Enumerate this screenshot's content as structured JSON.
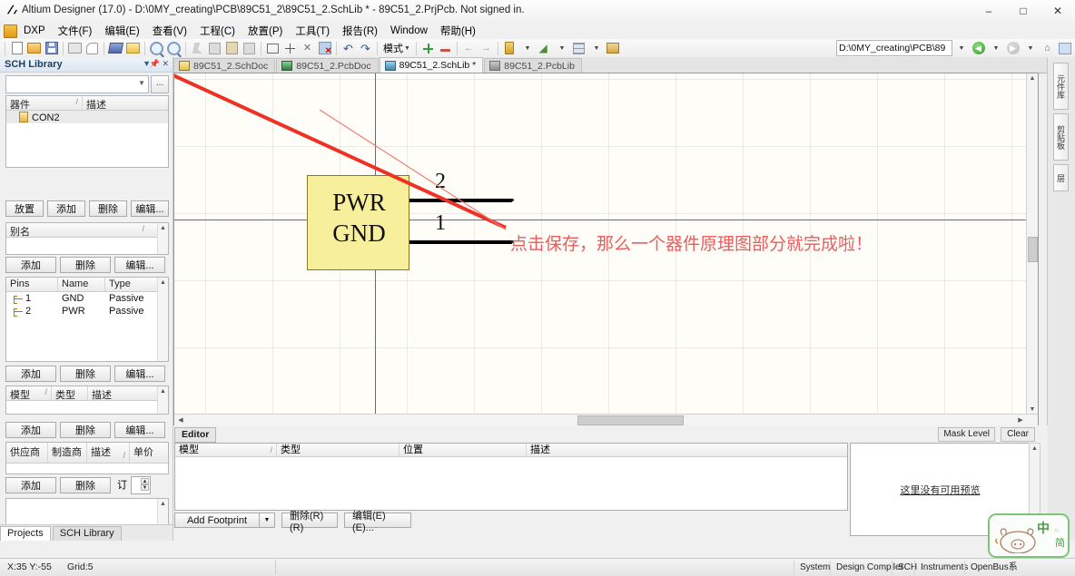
{
  "window": {
    "title": "Altium Designer (17.0) - D:\\0MY_creating\\PCB\\89C51_2\\89C51_2.SchLib * - 89C51_2.PrjPcb. Not signed in.",
    "minimize": "–",
    "maximize": "□",
    "close": "✕"
  },
  "menubar": {
    "items": [
      {
        "label": "DXP",
        "underline": "X"
      },
      {
        "label": "文件(F)",
        "underline": "F"
      },
      {
        "label": "编辑(E)",
        "underline": "E"
      },
      {
        "label": "查看(V)",
        "underline": "V"
      },
      {
        "label": "工程(C)",
        "underline": "C"
      },
      {
        "label": "放置(P)",
        "underline": "P"
      },
      {
        "label": "工具(T)",
        "underline": "T"
      },
      {
        "label": "报告(R)",
        "underline": "R"
      },
      {
        "label": "Window",
        "underline": "W"
      },
      {
        "label": "帮助(H)",
        "underline": "H"
      }
    ]
  },
  "toolbar": {
    "mode_label": "模式",
    "address_value": "D:\\0MY_creating\\PCB\\89",
    "buttons": [
      "new-document-icon",
      "open-folder-icon",
      "save-icon",
      "print-icon",
      "print-preview-icon",
      "layers-icon",
      "document-options-icon",
      "zoom-in-icon",
      "zoom-out-icon",
      "cut-icon",
      "copy-icon",
      "paste-icon",
      "paste-special-icon",
      "select-rectangle-icon",
      "move-icon",
      "deselect-icon",
      "clear-filter-icon",
      "undo-icon",
      "redo-icon",
      "add-icon",
      "remove-icon",
      "previous-part-icon",
      "next-part-icon",
      "place-pin-icon",
      "place-polygon-icon",
      "grid-icon",
      "place-image-icon"
    ],
    "nav": [
      "back-icon",
      "forward-icon",
      "home-icon",
      "refresh-icon"
    ]
  },
  "left_panel": {
    "title": "SCH Library",
    "header_buttons": [
      "chevron-down-icon",
      "pin-icon",
      "close-icon"
    ],
    "library_select": {
      "value": "",
      "ellipsis": "..."
    },
    "components": {
      "columns": [
        "器件",
        "描述"
      ],
      "sort_marker": "/",
      "rows": [
        {
          "name": "CON2",
          "description": ""
        }
      ]
    },
    "component_buttons": [
      "放置",
      "添加",
      "删除",
      "编辑..."
    ],
    "alias": {
      "columns": [
        "别名"
      ],
      "sort_marker": "/",
      "rows": [],
      "buttons": [
        "添加",
        "删除",
        "编辑..."
      ]
    },
    "pins": {
      "columns": [
        "Pins",
        "Name",
        "Type"
      ],
      "rows": [
        {
          "pin": "1",
          "name": "GND",
          "type": "Passive"
        },
        {
          "pin": "2",
          "name": "PWR",
          "type": "Passive"
        }
      ],
      "buttons": [
        "添加",
        "删除",
        "编辑..."
      ]
    },
    "models": {
      "columns": [
        "模型",
        "类型",
        "描述"
      ],
      "sort_marker": "/",
      "rows": [],
      "buttons": [
        "添加",
        "删除",
        "编辑..."
      ]
    },
    "suppliers": {
      "columns": [
        "供应商",
        "制造商",
        "描述",
        "单价"
      ],
      "sort_marker": "/",
      "rows": [],
      "buttons": [
        "添加",
        "删除"
      ],
      "order_label": "订"
    },
    "tabs": [
      {
        "label": "Projects",
        "active": true
      },
      {
        "label": "SCH Library",
        "active": false
      }
    ]
  },
  "doc_tabs": [
    {
      "label": "89C51_2.SchDoc",
      "icon": "schdoc-icon",
      "active": false,
      "modified": false
    },
    {
      "label": "89C51_2.PcbDoc",
      "icon": "pcbdoc-icon",
      "active": false,
      "modified": false
    },
    {
      "label": "89C51_2.SchLib *",
      "icon": "schlib-icon",
      "active": true,
      "modified": true
    },
    {
      "label": "89C51_2.PcbLib",
      "icon": "pcblib-icon",
      "active": false,
      "modified": false
    }
  ],
  "canvas": {
    "symbol": {
      "line1": "PWR",
      "line2": "GND",
      "fill_color": "#f7ef9c",
      "border_color": "#8a7a1e"
    },
    "pins": [
      {
        "number": "2",
        "net": "PWR"
      },
      {
        "number": "1",
        "net": "GND"
      }
    ],
    "annotation": {
      "text": "点击保存，那么一个器件原理图部分就完成啦！",
      "color": "#ef5b5b"
    },
    "pointer_color": "#ee3124"
  },
  "right_edge_tabs": [
    "元件库",
    "剪贴板",
    "层"
  ],
  "editor_pane": {
    "tab": "Editor",
    "mask_level": "Mask Level",
    "clear": "Clear",
    "footprint_table": {
      "columns": [
        "模型",
        "类型",
        "位置",
        "描述"
      ],
      "sort_marker": "/",
      "rows": []
    },
    "buttons": [
      {
        "label": "Add Footprint",
        "underline": "A",
        "split": true
      },
      {
        "label": "删除(R) (R)",
        "underline": "R",
        "split": false
      },
      {
        "label": "编辑(E) (E)...",
        "underline": "E",
        "split": false
      }
    ],
    "preview_text": "这里没有可用预览"
  },
  "status_bar": {
    "coords": "X:35 Y:-55",
    "grid": "Grid:5",
    "panels": [
      "System",
      "Design Compiler",
      "SCH",
      "Instruments",
      "OpenBus系"
    ]
  },
  "ime": {
    "mode": "中",
    "shape": "简"
  }
}
